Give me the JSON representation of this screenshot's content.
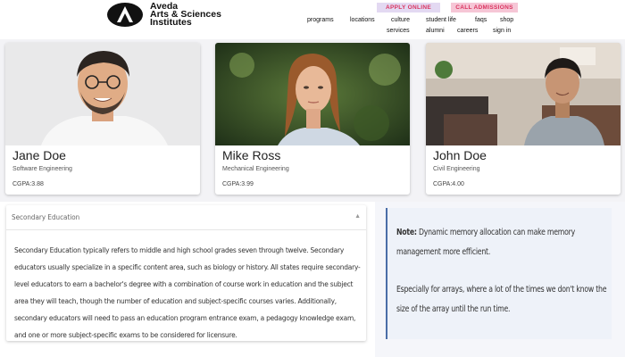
{
  "brand": {
    "line1": "Aveda",
    "line2": "Arts & Sciences",
    "line3": "Institutes"
  },
  "header_buttons": {
    "apply": "APPLY ONLINE",
    "call": "CALL ADMISSIONS"
  },
  "nav": {
    "row1": [
      "programs",
      "locations",
      "culture",
      "student life",
      "faqs",
      "shop"
    ],
    "row2": [
      "services",
      "alumni",
      "careers",
      "sign in"
    ]
  },
  "students": [
    {
      "name": "Jane Doe",
      "department": "Software Engineering",
      "gpa": "CGPA:3.88"
    },
    {
      "name": "Mike Ross",
      "department": "Mechanical Engineering",
      "gpa": "CGPA:3.99"
    },
    {
      "name": "John Doe",
      "department": "Civil Engineering",
      "gpa": "CGPA:4.00"
    }
  ],
  "accordion": {
    "title": "Secondary Education",
    "body": "Secondary Education typically refers to middle and high school grades seven through twelve. Secondary educators usually specialize in a specific content area, such as biology or history. All states require secondary-level educators to earn a bachelor's degree with a combination of course work in education and the subject area they will teach, though the number of education and subject-specific courses varies. Additionally, secondary educators will need to pass an education program entrance exam, a pedagogy knowledge exam, and one or more subject-specific exams to be considered for licensure."
  },
  "note": {
    "label": "Note:",
    "text1": " Dynamic memory allocation can make memory management more efficient.",
    "text2": "Especially for arrays, where a lot of the times we don't know the size of the array until the run time."
  },
  "colors": {
    "accent_pink": "#d9345f",
    "note_border": "#4a6da7"
  }
}
